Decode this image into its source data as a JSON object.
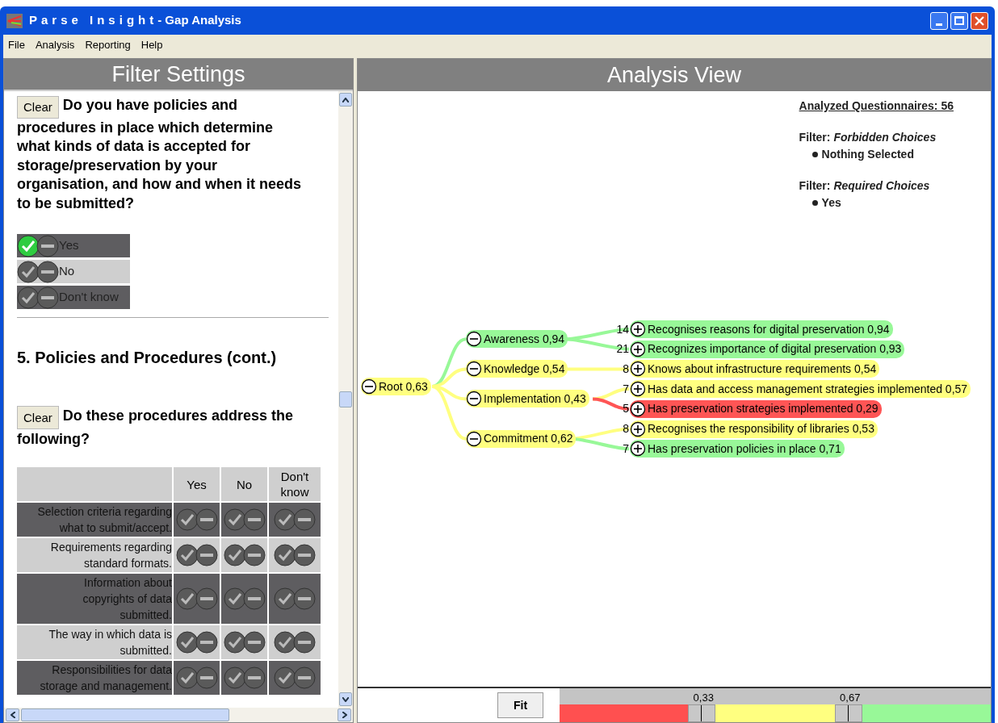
{
  "window": {
    "title_brand": "Parse Insight",
    "title_suffix": "- Gap Analysis"
  },
  "menu": [
    "File",
    "Analysis",
    "Reporting",
    "Help"
  ],
  "filter_panel": {
    "title": "Filter Settings",
    "question_1": {
      "clear": "Clear",
      "text": "Do you have policies and procedures in place which determine what kinds of data is accepted for storage/preservation by your organisation, and how and when it needs to be submitted?",
      "options": [
        {
          "label": "Yes",
          "required": true,
          "forbidden": false
        },
        {
          "label": "No",
          "required": false,
          "forbidden": false
        },
        {
          "label": "Don't know",
          "required": false,
          "forbidden": false
        }
      ]
    },
    "section_heading": "5. Policies and Procedures (cont.)",
    "question_2": {
      "clear": "Clear",
      "text": "Do these procedures address the following?",
      "columns": [
        "Yes",
        "No",
        "Don't\nknow"
      ],
      "rows": [
        {
          "label": "Selection criteria regarding what to submit/accept.",
          "cells": [
            {
              "required": false,
              "forbidden": false
            },
            {
              "required": false,
              "forbidden": false
            },
            {
              "required": false,
              "forbidden": false
            }
          ]
        },
        {
          "label": "Requirements regarding standard formats.",
          "cells": [
            {
              "required": false,
              "forbidden": false
            },
            {
              "required": false,
              "forbidden": false
            },
            {
              "required": false,
              "forbidden": false
            }
          ]
        },
        {
          "label": "Information about copyrights of data submitted.",
          "cells": [
            {
              "required": false,
              "forbidden": false
            },
            {
              "required": false,
              "forbidden": false
            },
            {
              "required": false,
              "forbidden": false
            }
          ]
        },
        {
          "label": "The way in which data is submitted.",
          "cells": [
            {
              "required": false,
              "forbidden": false
            },
            {
              "required": false,
              "forbidden": false
            },
            {
              "required": false,
              "forbidden": false
            }
          ]
        },
        {
          "label": "Responsibilities for data storage and management.",
          "cells": [
            {
              "required": false,
              "forbidden": false
            },
            {
              "required": false,
              "forbidden": false
            },
            {
              "required": false,
              "forbidden": false
            }
          ]
        }
      ]
    }
  },
  "analysis_view": {
    "title": "Analysis View",
    "analyzed": "Analyzed Questionnaires: 56",
    "filters": [
      {
        "heading": "Filter: *Forbidden Choices*",
        "items": [
          "Nothing Selected"
        ]
      },
      {
        "heading": "Filter: *Required Choices*",
        "items": [
          "Yes"
        ]
      }
    ],
    "tree": {
      "label": "Root 0,63",
      "color": "#ffff80",
      "expanded": true,
      "children": [
        {
          "label": "Awareness 0,94",
          "color": "#98f898",
          "expanded": true,
          "children": [
            {
              "count": "14",
              "label": "Recognises reasons for digital preservation 0,94",
              "color": "#98f898",
              "expanded": false
            },
            {
              "count": "21",
              "label": "Recognizes importance of digital preservation 0,93",
              "color": "#98f898",
              "expanded": false
            }
          ]
        },
        {
          "label": "Knowledge 0,54",
          "color": "#ffff80",
          "expanded": true,
          "children": [
            {
              "count": "8",
              "label": "Knows about infrastructure requirements 0,54",
              "color": "#ffff80",
              "expanded": false
            }
          ]
        },
        {
          "label": "Implementation 0,43",
          "color": "#ffff80",
          "expanded": true,
          "children": [
            {
              "count": "7",
              "label": "Has data and access management strategies implemented 0,57",
              "color": "#ffff80",
              "expanded": false
            },
            {
              "count": "5",
              "label": "Has preservation strategies implemented 0,29",
              "color": "#ff5555",
              "expanded": false
            }
          ]
        },
        {
          "label": "Commitment 0,62",
          "color": "#ffff80",
          "expanded": true,
          "children": [
            {
              "count": "8",
              "label": "Recognises the responsibility of libraries 0,53",
              "color": "#ffff80",
              "expanded": false
            },
            {
              "count": "7",
              "label": "Has preservation policies in place 0,71",
              "color": "#98f898",
              "expanded": false
            }
          ]
        }
      ]
    },
    "fit_button": "Fit",
    "thresholds": [
      {
        "label": "0,33",
        "level": 0.33
      },
      {
        "label": "0,67",
        "level": 0.67
      }
    ]
  }
}
